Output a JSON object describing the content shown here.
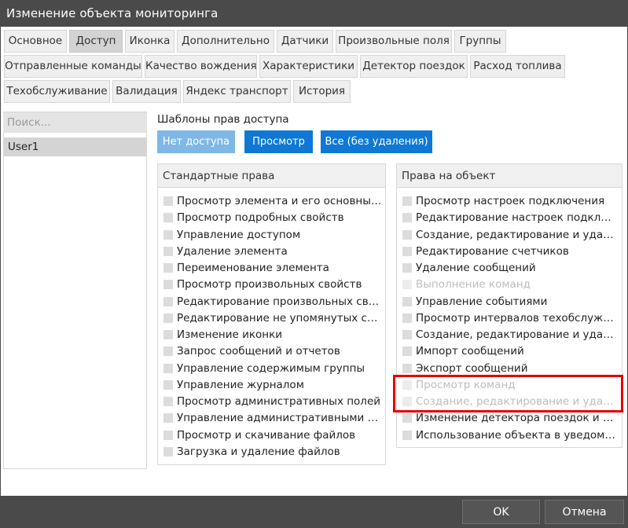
{
  "window": {
    "title": "Изменение объекта мониторинга"
  },
  "tabs": [
    {
      "label": "Основное",
      "active": false
    },
    {
      "label": "Доступ",
      "active": true
    },
    {
      "label": "Иконка",
      "active": false
    },
    {
      "label": "Дополнительно",
      "active": false
    },
    {
      "label": "Датчики",
      "active": false
    },
    {
      "label": "Произвольные поля",
      "active": false
    },
    {
      "label": "Группы",
      "active": false
    },
    {
      "label": "Отправленные команды",
      "active": false
    },
    {
      "label": "Качество вождения",
      "active": false
    },
    {
      "label": "Характеристики",
      "active": false
    },
    {
      "label": "Детектор поездок",
      "active": false
    },
    {
      "label": "Расход топлива",
      "active": false
    },
    {
      "label": "Техобслуживание",
      "active": false
    },
    {
      "label": "Валидация",
      "active": false
    },
    {
      "label": "Яндекс транспорт",
      "active": false
    },
    {
      "label": "История",
      "active": false
    }
  ],
  "users": {
    "search_placeholder": "Поиск...",
    "items": [
      "User1"
    ]
  },
  "templates": {
    "label": "Шаблоны прав доступа",
    "no_access": "Нет доступа",
    "view": "Просмотр",
    "all": "Все (без удаления)"
  },
  "standard": {
    "header": "Стандартные права",
    "items": [
      {
        "label": "Просмотр элемента и его основных свойств",
        "checked": false,
        "disabled": false
      },
      {
        "label": "Просмотр подробных свойств",
        "checked": false,
        "disabled": false
      },
      {
        "label": "Управление доступом",
        "checked": false,
        "disabled": false
      },
      {
        "label": "Удаление элемента",
        "checked": false,
        "disabled": false
      },
      {
        "label": "Переименование элемента",
        "checked": false,
        "disabled": false
      },
      {
        "label": "Просмотр произвольных свойств",
        "checked": false,
        "disabled": false
      },
      {
        "label": "Редактирование произвольных свойств",
        "checked": false,
        "disabled": false
      },
      {
        "label": "Редактирование не упомянутых свойств",
        "checked": false,
        "disabled": false
      },
      {
        "label": "Изменение иконки",
        "checked": false,
        "disabled": false
      },
      {
        "label": "Запрос сообщений и отчетов",
        "checked": false,
        "disabled": false
      },
      {
        "label": "Управление содержимым группы",
        "checked": false,
        "disabled": false
      },
      {
        "label": "Управление журналом",
        "checked": false,
        "disabled": false
      },
      {
        "label": "Просмотр административных полей",
        "checked": false,
        "disabled": false
      },
      {
        "label": "Управление административными полями",
        "checked": false,
        "disabled": false
      },
      {
        "label": "Просмотр и скачивание файлов",
        "checked": false,
        "disabled": false
      },
      {
        "label": "Загрузка и удаление файлов",
        "checked": false,
        "disabled": false
      }
    ]
  },
  "object": {
    "header": "Права на объект",
    "items": [
      {
        "label": "Просмотр настроек подключения",
        "checked": false,
        "disabled": false
      },
      {
        "label": "Редактирование настроек подключения",
        "checked": false,
        "disabled": false
      },
      {
        "label": "Создание, редактирование и удаление датчиков",
        "checked": false,
        "disabled": false
      },
      {
        "label": "Редактирование счетчиков",
        "checked": false,
        "disabled": false
      },
      {
        "label": "Удаление сообщений",
        "checked": false,
        "disabled": false
      },
      {
        "label": "Выполнение команд",
        "checked": false,
        "disabled": true
      },
      {
        "label": "Управление событиями",
        "checked": false,
        "disabled": false
      },
      {
        "label": "Просмотр интервалов техобслуживания",
        "checked": false,
        "disabled": false
      },
      {
        "label": "Создание, редактирование и удаление интервалов",
        "checked": false,
        "disabled": false
      },
      {
        "label": "Импорт сообщений",
        "checked": false,
        "disabled": false
      },
      {
        "label": "Экспорт сообщений",
        "checked": false,
        "disabled": false
      },
      {
        "label": "Просмотр команд",
        "checked": false,
        "disabled": true
      },
      {
        "label": "Создание, редактирование и удаление команд",
        "checked": false,
        "disabled": true
      },
      {
        "label": "Изменение детектора поездок и расхода топлива",
        "checked": false,
        "disabled": false
      },
      {
        "label": "Использование объекта в уведомлениях",
        "checked": false,
        "disabled": false
      }
    ]
  },
  "footer": {
    "ok": "OK",
    "cancel": "Отмена"
  },
  "colors": {
    "accent": "#0e78d4",
    "accent_light": "#7fb8e6",
    "highlight": "#e60000",
    "chrome": "#4a4a4a"
  }
}
